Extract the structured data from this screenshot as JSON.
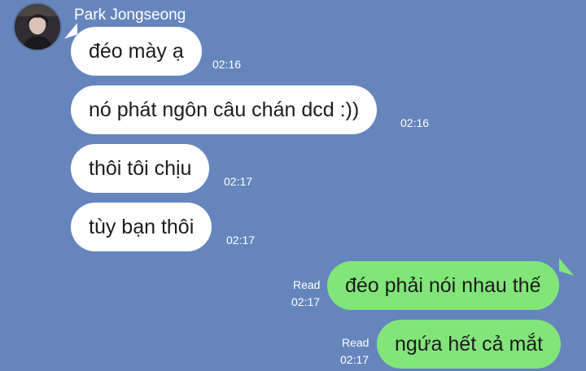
{
  "chat": {
    "sender": {
      "name": "Park Jongseong",
      "avatar_icon": "profile-photo"
    },
    "incoming": [
      {
        "text": "đéo mày ạ",
        "time": "02:16"
      },
      {
        "text": "nó phát ngôn câu chán dcd :))",
        "time": "02:16"
      },
      {
        "text": "thôi tôi chịu",
        "time": "02:17"
      },
      {
        "text": "tùy bạn thôi",
        "time": "02:17"
      }
    ],
    "outgoing": [
      {
        "text": "đéo phải nói nhau thế",
        "status": "Read",
        "time": "02:17"
      },
      {
        "text": "ngứa hết cả mắt",
        "status": "Read",
        "time": "02:17"
      }
    ],
    "colors": {
      "background": "#6685bd",
      "incoming_bubble": "#ffffff",
      "outgoing_bubble": "#82e57a"
    }
  }
}
